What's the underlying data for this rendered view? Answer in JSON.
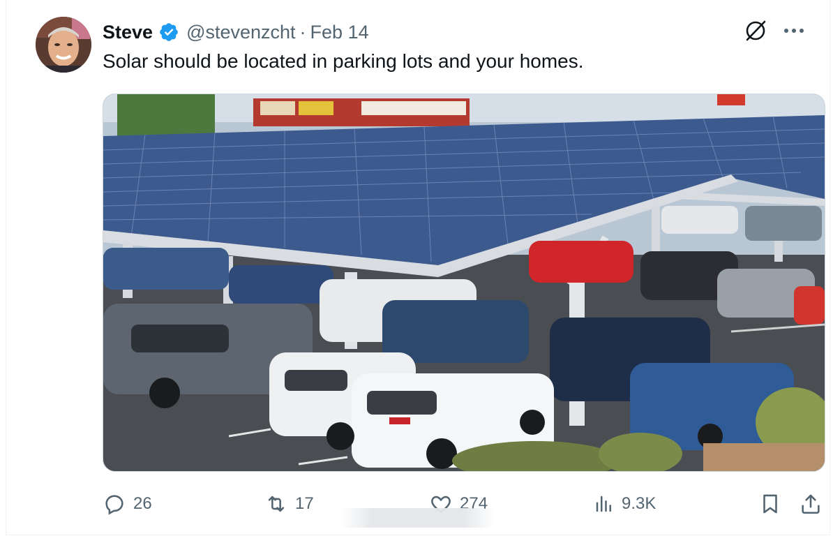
{
  "tweet": {
    "author_name": "Steve",
    "handle": "@stevenzcht",
    "separator": "·",
    "date": "Feb 14",
    "text": "Solar should be located in parking lots and your homes.",
    "media_alt": "Parking lot covered by solar panel carport canopy"
  },
  "icons": {
    "verified": "verified-badge-icon",
    "grok": "grok-icon",
    "more": "more-icon",
    "reply": "reply-icon",
    "retweet": "retweet-icon",
    "like": "like-icon",
    "views": "views-icon",
    "bookmark": "bookmark-icon",
    "share": "share-icon"
  },
  "stats": {
    "replies": "26",
    "retweets": "17",
    "likes": "274",
    "views": "9.3K"
  },
  "colors": {
    "verified": "#1d9bf0",
    "text": "#0f1419",
    "secondary": "#536471",
    "border": "#cfd9de"
  }
}
